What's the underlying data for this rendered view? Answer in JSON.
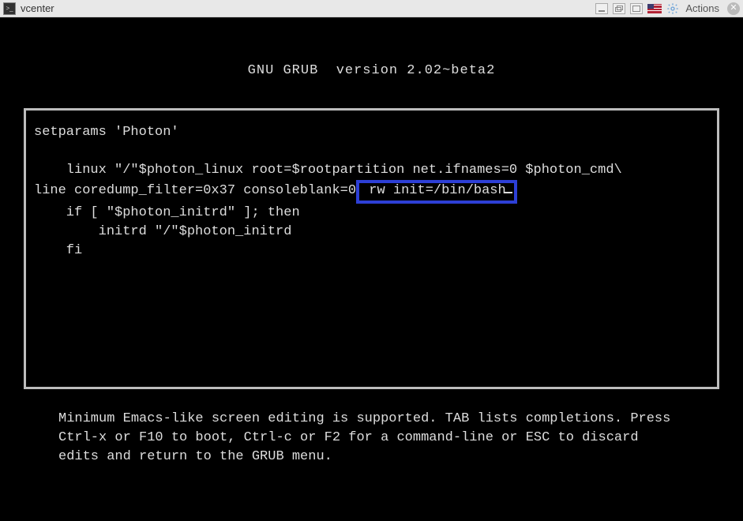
{
  "titlebar": {
    "title": "vcenter",
    "actions_label": "Actions"
  },
  "grub": {
    "header": "GNU GRUB  version 2.02~beta2",
    "line1": "setparams 'Photon'",
    "line2_pre": "    linux \"/\"$photon_linux root=$rootpartition net.ifnames=0 $photon_cmd\\",
    "line3_pre": "line coredump_filter=0x37 consoleblank=0",
    "line3_highlight": " rw init=/bin/bash",
    "line4": "    if [ \"$photon_initrd\" ]; then",
    "line5": "        initrd \"/\"$photon_initrd",
    "line6": "    fi",
    "footer": "Minimum Emacs-like screen editing is supported. TAB lists completions. Press Ctrl-x or F10 to boot, Ctrl-c or F2 for a command-line or ESC to discard edits and return to the GRUB menu."
  }
}
